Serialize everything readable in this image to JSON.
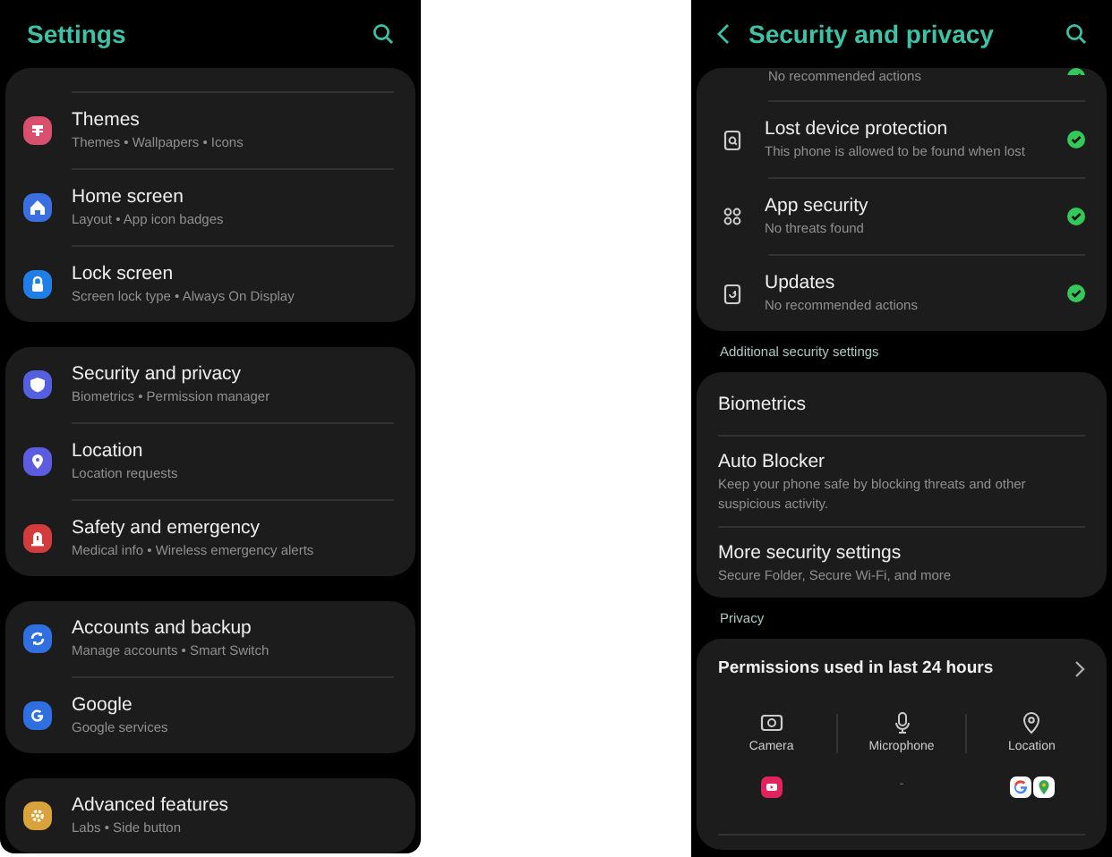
{
  "settings_screen": {
    "title": "Settings",
    "groups": [
      {
        "cut_top": true,
        "items": [
          {
            "kind": "brush",
            "color": "#d9506f",
            "title": "Themes",
            "subtitle": "Themes  •  Wallpapers  •  Icons"
          },
          {
            "kind": "home",
            "color": "#3b6fe0",
            "title": "Home screen",
            "subtitle": "Layout  •  App icon badges"
          },
          {
            "kind": "lock",
            "color": "#1f7fe6",
            "title": "Lock screen",
            "subtitle": "Screen lock type  •  Always On Display"
          }
        ]
      },
      {
        "cut_top": false,
        "items": [
          {
            "kind": "shield",
            "color": "#5560e0",
            "title": "Security and privacy",
            "subtitle": "Biometrics  •  Permission manager"
          },
          {
            "kind": "pin",
            "color": "#5c5ce0",
            "title": "Location",
            "subtitle": "Location requests"
          },
          {
            "kind": "alert",
            "color": "#d23c3c",
            "title": "Safety and emergency",
            "subtitle": "Medical info  •  Wireless emergency alerts"
          }
        ]
      },
      {
        "cut_top": false,
        "items": [
          {
            "kind": "sync",
            "color": "#2f6fe0",
            "title": "Accounts and backup",
            "subtitle": "Manage accounts  •  Smart Switch"
          },
          {
            "kind": "google",
            "color": "#2f6fe0",
            "title": "Google",
            "subtitle": "Google services"
          }
        ]
      },
      {
        "cut_top": false,
        "items": [
          {
            "kind": "gear",
            "color": "#d9a23a",
            "title": "Advanced features",
            "subtitle": "Labs  •  Side button"
          }
        ]
      }
    ]
  },
  "security_screen": {
    "title": "Security and privacy",
    "partial_item": {
      "subtitle": "No recommended actions",
      "ok": true
    },
    "status_items": [
      {
        "kind": "phone-search",
        "title": "Lost device protection",
        "subtitle": "This phone is allowed to be found when lost",
        "ok": true
      },
      {
        "kind": "apps",
        "title": "App security",
        "subtitle": "No threats found",
        "ok": true
      },
      {
        "kind": "update",
        "title": "Updates",
        "subtitle": "No recommended actions",
        "ok": true
      }
    ],
    "additional_label": "Additional security settings",
    "additional_items": [
      {
        "title": "Biometrics"
      },
      {
        "title": "Auto Blocker",
        "subtitle": "Keep your phone safe by blocking threats and other suspicious activity."
      },
      {
        "title": "More security settings",
        "subtitle": "Secure Folder, Secure Wi-Fi, and more"
      }
    ],
    "privacy_label": "Privacy",
    "permissions": {
      "title": "Permissions used in last 24 hours",
      "columns": [
        {
          "kind": "camera",
          "label": "Camera",
          "apps": [
            {
              "kind": "video",
              "color": "#e0245e"
            }
          ]
        },
        {
          "kind": "mic",
          "label": "Microphone",
          "none_text": "-"
        },
        {
          "kind": "location",
          "label": "Location",
          "apps": [
            {
              "kind": "google",
              "color": "#ffffff"
            },
            {
              "kind": "maps",
              "color": "#ffffff"
            }
          ]
        }
      ]
    }
  }
}
